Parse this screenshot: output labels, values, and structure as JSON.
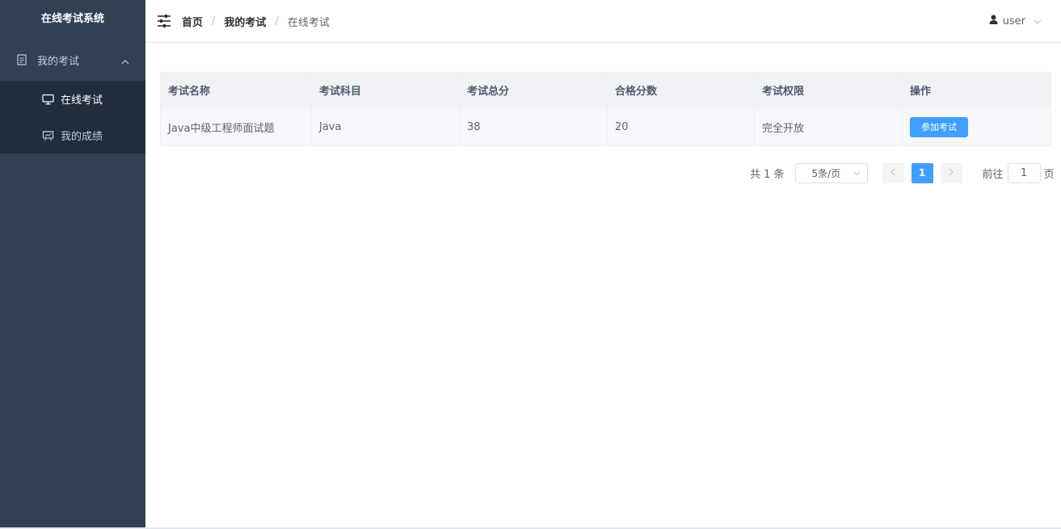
{
  "sidebar": {
    "title": "在线考试系统",
    "group": {
      "label": "我的考试",
      "icon": "document-icon",
      "expanded": true
    },
    "items": [
      {
        "label": "在线考试",
        "icon": "monitor-icon",
        "active": true
      },
      {
        "label": "我的成绩",
        "icon": "chart-board-icon",
        "active": false
      }
    ]
  },
  "header": {
    "breadcrumb": [
      "首页",
      "我的考试",
      "在线考试"
    ],
    "separator": "/",
    "user": "user"
  },
  "table": {
    "columns": [
      "考试名称",
      "考试科目",
      "考试总分",
      "合格分数",
      "考试权限",
      "操作"
    ],
    "rows": [
      {
        "name": "Java中级工程师面试题",
        "subject": "Java",
        "total": "38",
        "pass": "20",
        "permission": "完全开放",
        "action": "参加考试"
      }
    ]
  },
  "pagination": {
    "total_text": "共 1 条",
    "page_size": "5条/页",
    "current_page": "1",
    "goto_prefix": "前往",
    "goto_value": "1",
    "goto_suffix": "页"
  },
  "colors": {
    "sidebar_bg": "#304156",
    "submenu_bg": "#1f2d3d",
    "primary": "#409eff"
  }
}
